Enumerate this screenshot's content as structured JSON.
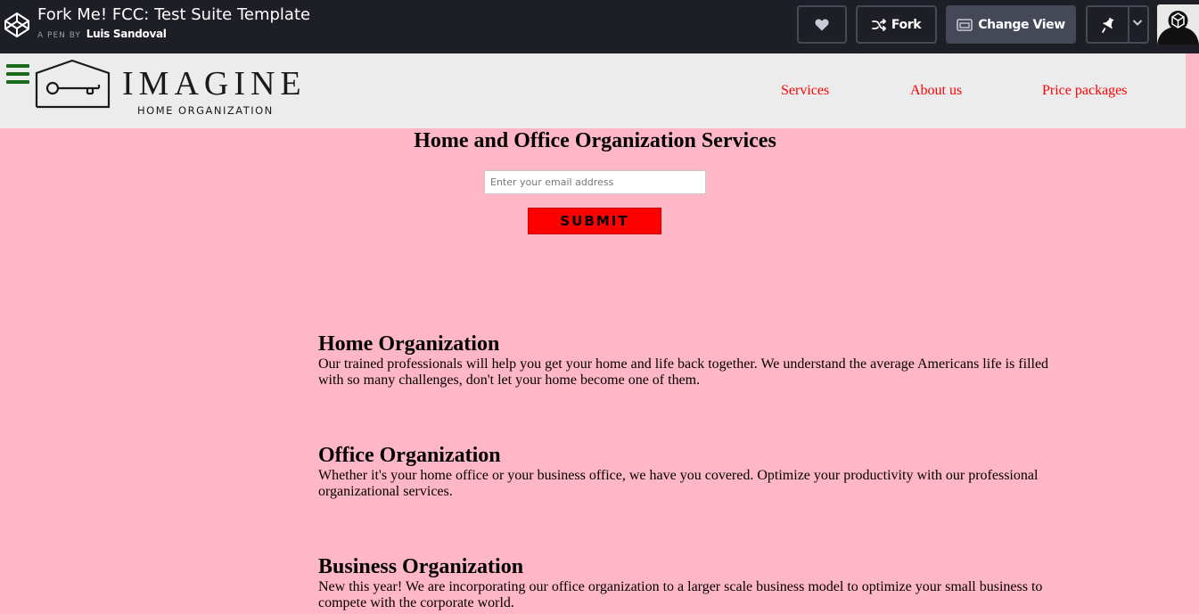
{
  "codepen": {
    "title": "Fork Me! FCC: Test Suite Template",
    "by_label": "A PEN BY",
    "author": "Luis Sandoval",
    "fork_label": "Fork",
    "change_view_label": "Change View",
    "icons": {
      "logo": "codepen-logo-icon",
      "heart": "heart-icon",
      "fork": "fork-icon",
      "change_view": "change-view-icon",
      "pin": "pin-icon",
      "chevron": "chevron-down-icon"
    }
  },
  "header": {
    "logo_word": "IMAGINE",
    "logo_sub": "HOME ORGANIZATION",
    "nav": [
      "Services",
      "About us",
      "Price packages"
    ],
    "nav_color": "#ff0000",
    "menu_icon": "hamburger-icon",
    "menu_color": "#1c6b1c"
  },
  "hero": {
    "title": "Home and Office Organization Services",
    "email_placeholder": "Enter your email address",
    "submit_label": "SUBMIT",
    "submit_color": "#ff0000"
  },
  "sections": [
    {
      "heading": "Home Organization",
      "text": "Our trained professionals will help you get your home and life back together. We understand the average Americans life is filled with so many challenges, don't let your home become one of them."
    },
    {
      "heading": "Office Organization",
      "text": "Whether it's your home office or your business office, we have you covered. Optimize your productivity with our professional organizational services."
    },
    {
      "heading": "Business Organization",
      "text": "New this year! We are incorporating our office organization to a larger scale business model to optimize your small business to compete with the corporate world."
    }
  ],
  "colors": {
    "page_background": "#ffb6c6",
    "header_background": "#ececec",
    "codepen_bar": "#1e1f26"
  }
}
